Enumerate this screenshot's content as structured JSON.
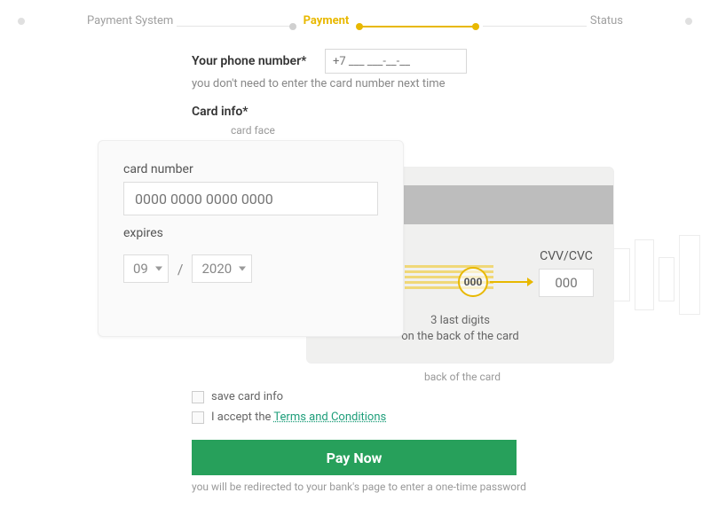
{
  "stepper": {
    "step1": "Payment System",
    "step2": "Payment",
    "step3": "Status"
  },
  "phone": {
    "label": "Your phone number*",
    "placeholder": "+7 ___ ___-__-__",
    "hint": "you don't need to enter the card number next time"
  },
  "card": {
    "section_label": "Card info*",
    "face_label": "card face",
    "back_label": "back of the card",
    "number_label": "card number",
    "number_placeholder": "0000 0000 0000 0000",
    "expires_label": "expires",
    "month": "09",
    "year": "2020",
    "slash": "/",
    "cvv_label": "CVV/CVC",
    "cvv_placeholder": "000",
    "cvv_badge": "000",
    "cvv_hint_line1": "3 last digits",
    "cvv_hint_line2": "on the back of the card"
  },
  "checks": {
    "save": "save card info",
    "accept_prefix": "I accept the ",
    "tc": "Terms and Conditions"
  },
  "actions": {
    "pay": "Pay Now",
    "redirect_hint": "you will be redirected to your bank's page to enter a one-time password"
  },
  "colors": {
    "accent": "#e8b800",
    "primary": "#27a05b"
  }
}
